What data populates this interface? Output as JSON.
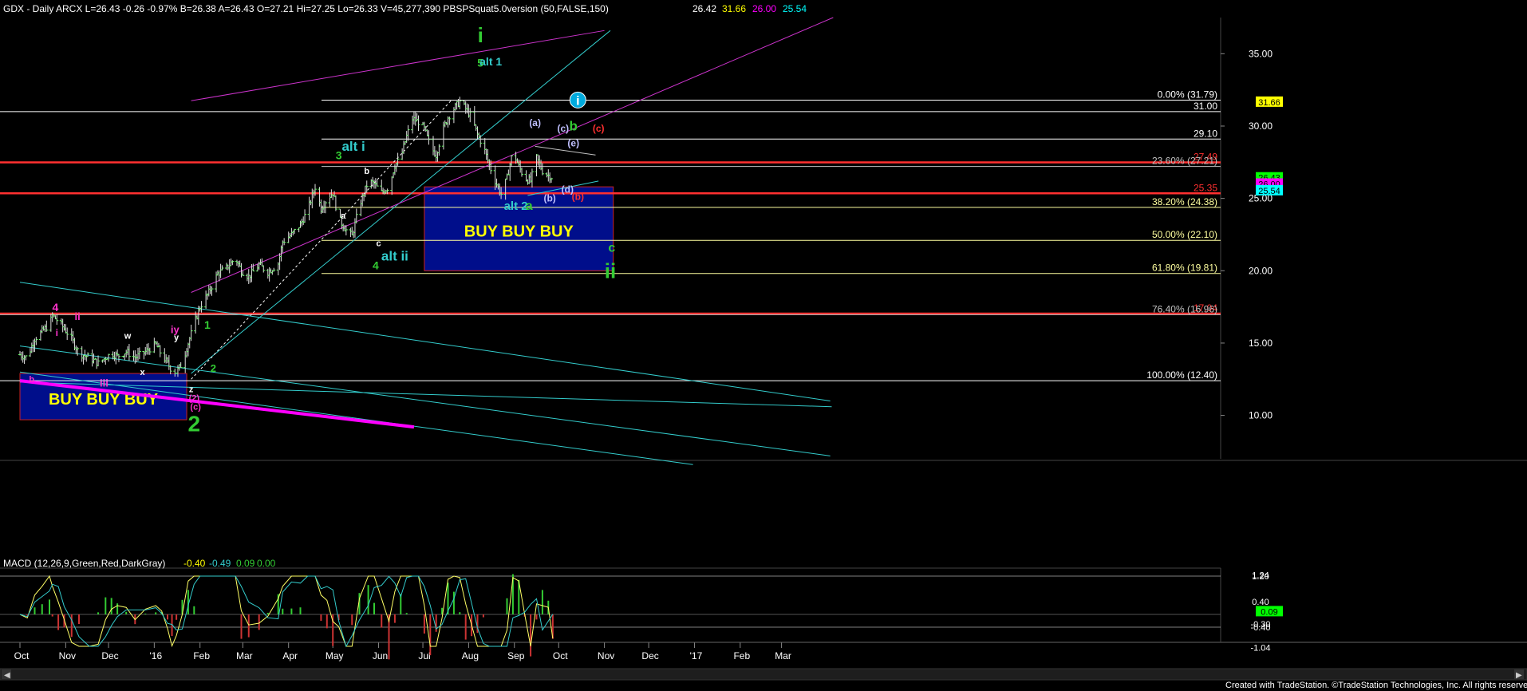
{
  "header": {
    "symbol_info": "GDX - Daily  ARCX  L=26.43  -0.26  -0.97%  B=26.38  A=26.43  O=27.21  Hi=27.25  Lo=26.33  V=45,277,390  PBSPSquat5.0version (50,FALSE,150)",
    "v1": "26.42",
    "v2": "31.66",
    "v3": "26.00",
    "v4": "25.54",
    "c1": "#ffffff",
    "c2": "#ffff00",
    "c3": "#ff00ff",
    "c4": "#00ffff"
  },
  "macd": {
    "label": "MACD (12,26,9,Green,Red,DarkGray)",
    "v1": "-0.40",
    "v2": "-0.49",
    "v3": "0.09",
    "v4": "0.00",
    "axis_labels": [
      "1.24",
      "1.20",
      "0.40",
      "-0.30",
      "-0.40",
      "-1.04"
    ],
    "badge": "0.09"
  },
  "footer": "Created with TradeStation. ©TradeStation Technologies, Inc. All rights reserved.",
  "chart_data": {
    "type": "ohlc",
    "symbol": "GDX",
    "ylim": [
      7.0,
      37.5
    ],
    "yticks": [
      10.0,
      15.0,
      20.0,
      25.0,
      30.0,
      35.0
    ],
    "ytick_labels": [
      "10.00",
      "15.00",
      "20.00",
      "25.00",
      "30.00",
      "35.00"
    ],
    "x_labels": [
      "Oct",
      "Nov",
      "Dec",
      "'16",
      "Feb",
      "Mar",
      "Apr",
      "May",
      "Jun",
      "Jul",
      "Aug",
      "Sep",
      "Oct",
      "Nov",
      "Dec",
      "'17",
      "Feb",
      "Mar"
    ],
    "x_label_day": [
      0,
      31,
      60,
      91,
      122,
      151,
      182,
      212,
      243,
      273,
      304,
      335,
      365,
      396,
      426,
      457,
      488,
      516
    ],
    "last_price": 26.43,
    "price_path": [
      [
        0,
        14.2
      ],
      [
        5,
        14.0
      ],
      [
        10,
        15.3
      ],
      [
        15,
        15.8
      ],
      [
        20,
        16.3
      ],
      [
        22,
        16.9
      ],
      [
        26,
        16.5
      ],
      [
        30,
        16.0
      ],
      [
        35,
        15.3
      ],
      [
        40,
        14.3
      ],
      [
        47,
        14.0
      ],
      [
        53,
        13.6
      ],
      [
        58,
        14.0
      ],
      [
        62,
        14.3
      ],
      [
        66,
        14.1
      ],
      [
        72,
        14.4
      ],
      [
        78,
        14.0
      ],
      [
        85,
        14.4
      ],
      [
        92,
        14.9
      ],
      [
        96,
        14.2
      ],
      [
        100,
        13.6
      ],
      [
        103,
        13.1
      ],
      [
        106,
        13.0
      ],
      [
        110,
        13.6
      ],
      [
        114,
        15.0
      ],
      [
        118,
        16.3
      ],
      [
        122,
        17.5
      ],
      [
        128,
        18.5
      ],
      [
        134,
        19.8
      ],
      [
        140,
        20.2
      ],
      [
        146,
        20.9
      ],
      [
        150,
        20.0
      ],
      [
        155,
        19.6
      ],
      [
        162,
        20.4
      ],
      [
        168,
        19.9
      ],
      [
        175,
        20.5
      ],
      [
        178,
        22.0
      ],
      [
        184,
        22.5
      ],
      [
        190,
        23.2
      ],
      [
        195,
        24.2
      ],
      [
        200,
        25.8
      ],
      [
        204,
        24.3
      ],
      [
        208,
        25.0
      ],
      [
        212,
        25.4
      ],
      [
        216,
        23.6
      ],
      [
        221,
        22.8
      ],
      [
        225,
        22.4
      ],
      [
        230,
        24.5
      ],
      [
        236,
        26.2
      ],
      [
        240,
        26.0
      ],
      [
        245,
        25.4
      ],
      [
        250,
        25.8
      ],
      [
        254,
        27.3
      ],
      [
        258,
        27.8
      ],
      [
        262,
        29.3
      ],
      [
        266,
        30.5
      ],
      [
        270,
        30.3
      ],
      [
        274,
        29.8
      ],
      [
        278,
        28.6
      ],
      [
        282,
        28.0
      ],
      [
        286,
        29.6
      ],
      [
        290,
        30.6
      ],
      [
        294,
        31.2
      ],
      [
        298,
        31.7
      ],
      [
        302,
        31.2
      ],
      [
        306,
        30.6
      ],
      [
        310,
        29.4
      ],
      [
        314,
        28.6
      ],
      [
        318,
        27.3
      ],
      [
        322,
        26.2
      ],
      [
        326,
        25.3
      ],
      [
        330,
        26.4
      ],
      [
        334,
        28.3
      ],
      [
        338,
        27.2
      ],
      [
        342,
        26.4
      ],
      [
        346,
        26.2
      ],
      [
        350,
        27.8
      ],
      [
        354,
        26.9
      ],
      [
        358,
        26.6
      ],
      [
        361,
        26.43
      ]
    ],
    "horizontal_levels": [
      {
        "price": 31.79,
        "label": "0.00% (31.79)",
        "color": "#ffffff"
      },
      {
        "price": 31.0,
        "label": "31.00",
        "color": "#ffffff"
      },
      {
        "price": 29.1,
        "label": "29.10",
        "color": "#ffffff"
      },
      {
        "price": 27.49,
        "label": "27.49",
        "color": "#ff3030"
      },
      {
        "price": 27.21,
        "label": "23.60% (27.21)",
        "color": "#c0c0c0"
      },
      {
        "price": 25.35,
        "label": "25.35",
        "color": "#ff3030"
      },
      {
        "price": 24.38,
        "label": "38.20% (24.38)",
        "color": "#ffffa0"
      },
      {
        "price": 22.1,
        "label": "50.00% (22.10)",
        "color": "#ffffa0"
      },
      {
        "price": 19.81,
        "label": "61.80% (19.81)",
        "color": "#ffffa0"
      },
      {
        "price": 17.04,
        "label": "17.04",
        "color": "#ff3030"
      },
      {
        "price": 16.96,
        "label": "76.40% (16.96)",
        "color": "#c0c0c0"
      },
      {
        "price": 12.4,
        "label": "100.00% (12.40)",
        "color": "#ffffff"
      }
    ],
    "right_badges": [
      {
        "price": 31.66,
        "label": "31.66",
        "bg": "#ffff00"
      },
      {
        "price": 26.43,
        "label": "26.43",
        "bg": "#00ff00"
      },
      {
        "price": 26.0,
        "label": "26.00",
        "bg": "#ff00ff"
      },
      {
        "price": 25.54,
        "label": "25.54",
        "bg": "#00ffff"
      }
    ],
    "boxes": [
      {
        "x0": 0,
        "x1": 113,
        "p_top": 12.9,
        "p_bot": 9.7,
        "label": "BUY BUY BUY"
      },
      {
        "x0": 274,
        "x1": 402,
        "p_top": 25.8,
        "p_bot": 20.0,
        "label": "BUY  BUY  BUY"
      }
    ],
    "annotations": [
      {
        "t": "i",
        "d": 312,
        "p": 35.8,
        "c": "#33cc33",
        "s": 26
      },
      {
        "t": "5",
        "d": 312,
        "p": 34.1,
        "c": "#33cc33",
        "s": 14
      },
      {
        "t": "alt 1",
        "d": 319,
        "p": 34.2,
        "c": "#33cccc",
        "s": 14
      },
      {
        "t": "alt i",
        "d": 226,
        "p": 28.3,
        "c": "#33cccc",
        "s": 17
      },
      {
        "t": "3",
        "d": 216,
        "p": 27.7,
        "c": "#33cc33",
        "s": 14
      },
      {
        "t": "b",
        "d": 235,
        "p": 26.7,
        "c": "#ffffff",
        "s": 11
      },
      {
        "t": "a",
        "d": 219,
        "p": 23.6,
        "c": "#ffffff",
        "s": 11
      },
      {
        "t": "c",
        "d": 243,
        "p": 21.7,
        "c": "#ffffff",
        "s": 11
      },
      {
        "t": "4",
        "d": 241,
        "p": 20.1,
        "c": "#33cc33",
        "s": 14
      },
      {
        "t": "alt ii",
        "d": 254,
        "p": 20.7,
        "c": "#33cccc",
        "s": 17
      },
      {
        "t": "(a)",
        "d": 349,
        "p": 30.0,
        "c": "#c0c0ff",
        "s": 12
      },
      {
        "t": "(c)",
        "d": 368,
        "p": 29.6,
        "c": "#c0c0ff",
        "s": 12
      },
      {
        "t": "b",
        "d": 375,
        "p": 29.7,
        "c": "#33cc33",
        "s": 17
      },
      {
        "t": "(c)",
        "d": 392,
        "p": 29.6,
        "c": "#ff3030",
        "s": 12
      },
      {
        "t": "(e)",
        "d": 375,
        "p": 28.6,
        "c": "#c0c0ff",
        "s": 12
      },
      {
        "t": "(d)",
        "d": 371,
        "p": 25.4,
        "c": "#c0c0ff",
        "s": 12
      },
      {
        "t": "(b)",
        "d": 359,
        "p": 24.8,
        "c": "#c0c0ff",
        "s": 12
      },
      {
        "t": "(b)",
        "d": 378,
        "p": 24.9,
        "c": "#ff3030",
        "s": 12
      },
      {
        "t": "alt 2",
        "d": 336,
        "p": 24.2,
        "c": "#33cccc",
        "s": 15
      },
      {
        "t": "a",
        "d": 345,
        "p": 24.2,
        "c": "#33cc33",
        "s": 16
      },
      {
        "t": "c",
        "d": 401,
        "p": 21.3,
        "c": "#33cc33",
        "s": 16
      },
      {
        "t": "ii",
        "d": 400,
        "p": 19.5,
        "c": "#33cc33",
        "s": 26
      },
      {
        "t": "4",
        "d": 24,
        "p": 17.2,
        "c": "#ff33cc",
        "s": 14
      },
      {
        "t": "ii",
        "d": 39,
        "p": 16.6,
        "c": "#ff33cc",
        "s": 13
      },
      {
        "t": "i",
        "d": 25,
        "p": 15.5,
        "c": "#ff33cc",
        "s": 12
      },
      {
        "t": "b",
        "d": 8,
        "p": 12.3,
        "c": "#ff33cc",
        "s": 11
      },
      {
        "t": "iii",
        "d": 57,
        "p": 12.0,
        "c": "#ff33cc",
        "s": 13
      },
      {
        "t": "w",
        "d": 73,
        "p": 15.3,
        "c": "#ffffff",
        "s": 11
      },
      {
        "t": "x",
        "d": 83,
        "p": 12.8,
        "c": "#ffffff",
        "s": 11
      },
      {
        "t": "y",
        "d": 106,
        "p": 15.2,
        "c": "#ffffff",
        "s": 11
      },
      {
        "t": "iy",
        "d": 105,
        "p": 15.7,
        "c": "#ff33cc",
        "s": 13
      },
      {
        "t": "1",
        "d": 127,
        "p": 16.0,
        "c": "#33cc33",
        "s": 14
      },
      {
        "t": "2",
        "d": 131,
        "p": 13.0,
        "c": "#33cc33",
        "s": 13
      },
      {
        "t": "z",
        "d": 116,
        "p": 11.6,
        "c": "#ffffff",
        "s": 11
      },
      {
        "t": "(2)",
        "d": 118,
        "p": 11.0,
        "c": "#ff33cc",
        "s": 11
      },
      {
        "t": "(c)",
        "d": 119,
        "p": 10.4,
        "c": "#ff33cc",
        "s": 11
      },
      {
        "t": "2",
        "d": 118,
        "p": 8.9,
        "c": "#33cc33",
        "s": 28
      }
    ],
    "trendlines": [
      {
        "d0": 116,
        "p0": 12.9,
        "d1": 400,
        "p1": 36.6,
        "color": "#33cccc"
      },
      {
        "d0": 116,
        "p0": 31.75,
        "d1": 396,
        "p1": 36.6,
        "color": "#cc33cc"
      },
      {
        "d0": 116,
        "p0": 18.5,
        "d1": 551,
        "p1": 37.5,
        "color": "#cc33cc"
      },
      {
        "d0": 116,
        "p0": 12.5,
        "d1": 292,
        "p1": 31.75,
        "color": "#ffffff",
        "dash": true
      },
      {
        "d0": 0,
        "p0": 19.2,
        "d1": 549,
        "p1": 11.0,
        "color": "#33cccc"
      },
      {
        "d0": 0,
        "p0": 14.8,
        "d1": 549,
        "p1": 7.2,
        "color": "#33cccc"
      },
      {
        "d0": 0,
        "p0": 13.0,
        "d1": 456,
        "p1": 6.6,
        "color": "#33cccc"
      },
      {
        "d0": 0,
        "p0": 12.3,
        "d1": 550,
        "p1": 10.6,
        "color": "#33cccc"
      },
      {
        "d0": 0,
        "p0": 12.4,
        "d1": 267,
        "p1": 9.2,
        "color": "#ff00ff",
        "width": 4
      },
      {
        "d0": 344,
        "p0": 25.2,
        "d1": 392,
        "p1": 26.2,
        "color": "#33cccc"
      },
      {
        "d0": 349,
        "p0": 28.6,
        "d1": 390,
        "p1": 28.0,
        "color": "#c0c0c0"
      }
    ],
    "circle_marker": {
      "d": 378,
      "p": 31.8,
      "label": "i"
    }
  }
}
